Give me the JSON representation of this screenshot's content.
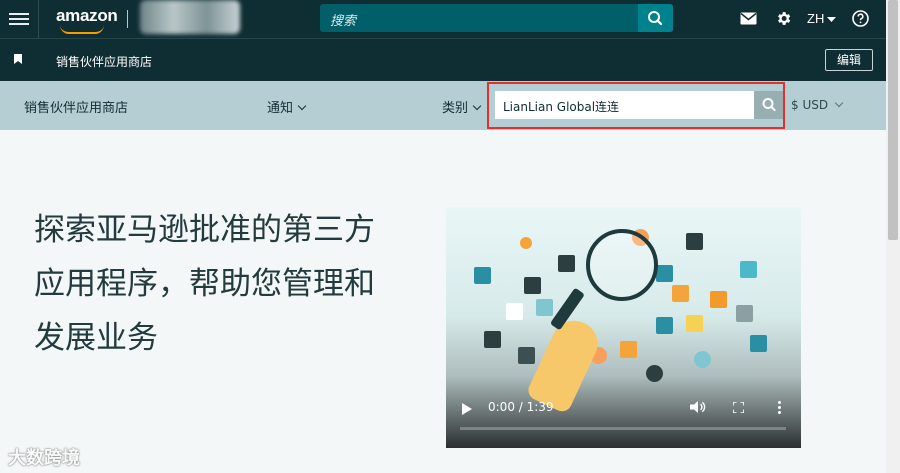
{
  "topbar": {
    "logo_text": "amazon",
    "search_placeholder": "搜索",
    "lang": "ZH"
  },
  "bar2": {
    "title": "销售伙伴应用商店",
    "edit_label": "编辑"
  },
  "navbar": {
    "store_label": "销售伙伴应用商店",
    "notify_label": "通知",
    "category_label": "类别",
    "search_value": "LianLian Global连连",
    "currency": "$ USD"
  },
  "hero": {
    "title": "探索亚马逊批准的第三方应用程序，帮助您管理和发展业务"
  },
  "video": {
    "time": "0:00 / 1:39",
    "progress": 0.0
  },
  "watermark": {
    "text": "大数跨境"
  },
  "colors": {
    "topbar_bg": "#0f2e33",
    "nav_bg": "#b4ced3",
    "search_bg": "#005f68",
    "highlight": "#e0312f"
  }
}
